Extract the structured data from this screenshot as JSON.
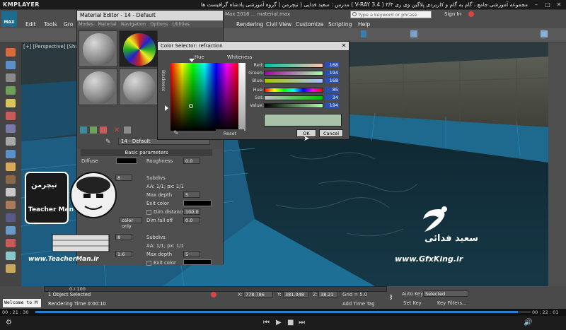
{
  "kmplayer": {
    "logo": "KMPLAYER",
    "title": "مجموعه آموزشی جامع ، گام به گام و کاربردی پلاگین وی ری ۳/۴  ( V-RAY 3.4 )  مدرس : سعید فدایی ( تیچرمن ) گروه آموزشی پادشاه گرافیست ها",
    "time_elapsed": "00 : 21 : 30",
    "time_total": "00 : 22 : 01"
  },
  "max": {
    "logo": "MAX",
    "menus": [
      "Edit",
      "Tools",
      "Gro",
      "Rendering",
      "Civil View",
      "Customize",
      "Scripting",
      "Help"
    ],
    "title_fragment": "Max 2016 ...    material.max",
    "search_placeholder": "Type a keyword or phrase",
    "sign_in": "Sign In",
    "viewport_label": "[+] [Perspective] [Shad",
    "status_selected": "1 Object Selected",
    "status_render_time": "Rendering Time 0:00:10",
    "x_label": "X:",
    "x_value": "778.786",
    "y_label": "Y:",
    "y_value": "381.048",
    "z_label": "Z:",
    "z_value": "38.21",
    "grid": "Grid = 5.0",
    "add_time_tag": "Add Time Tag",
    "auto_key": "Auto Key",
    "selected_dd": "Selected",
    "set_key": "Set Key",
    "key_filters": "Key Filters...",
    "timeline_counter": "0 / 100",
    "welcome": "Welcome to M"
  },
  "material_editor": {
    "title": "Material Editor - 14 - Default",
    "menus": [
      "Modes",
      "Material",
      "Navigation",
      "Options",
      "Utilities"
    ],
    "mat_name": "14 - Default",
    "rollout_title": "Basic parameters",
    "diffuse_label": "Diffuse",
    "roughness_label": "Roughness",
    "roughness_value": "0.0",
    "subdivs_label": "Subdivs",
    "subdivs_value": "8",
    "aa_label": "AA: 1/1; px: 1/1",
    "max_depth_label": "Max depth",
    "max_depth_value": "5",
    "exit_color_label": "Exit color",
    "dim_distance_label": "Dim distance",
    "dim_distance_value": "100.0",
    "dim_falloff_label": "Dim fall off",
    "dim_falloff_value": "0.0",
    "color_only": "color only",
    "val_1_6": "1.6",
    "val_8b": "8",
    "aa2_label": "AA: 1/1; px: 1/1",
    "max_depth2_label": "Max depth",
    "max_depth2_value": "5",
    "exit_color2_label": "Exit color"
  },
  "color_selector": {
    "title": "Color Selector: refraction",
    "hue_label": "Hue",
    "whiteness_label": "Whiteness",
    "blackness_label": "Blackness",
    "red_label": "Red:",
    "red_value": "168",
    "green_label": "Green:",
    "green_value": "194",
    "blue_label": "Blue:",
    "blue_value": "168",
    "hue2_label": "Hue:",
    "hue2_value": "85",
    "sat_label": "Sat:",
    "sat_value": "34",
    "value_label": "Value:",
    "value_value": "194",
    "reset_label": "Reset",
    "ok_label": "OK",
    "cancel_label": "Cancel",
    "current_color": "#a8c2a8"
  },
  "watermark": {
    "teacher_name": "Teacher Man",
    "teacher_sub": "تیچرمن",
    "teacher_url": "www.TeacherMan.ir",
    "gfx_name": "سعید فدائی",
    "gfx_url": "www.GfxKing.ir"
  }
}
